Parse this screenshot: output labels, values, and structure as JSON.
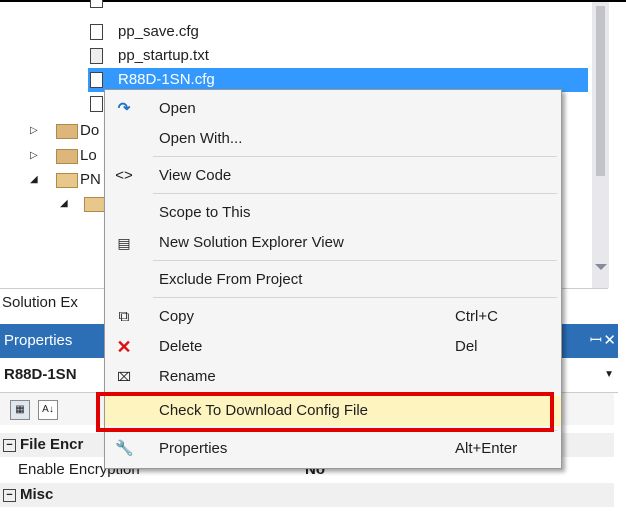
{
  "tree": {
    "items": [
      {
        "label": "pp_save.cfg",
        "type": "file"
      },
      {
        "label": "pp_startup.txt",
        "type": "file"
      },
      {
        "label": "R88D-1SN.cfg",
        "type": "file",
        "selected": true
      },
      {
        "label": "",
        "type": "file"
      },
      {
        "label": "Do",
        "type": "folder",
        "expander": "▷"
      },
      {
        "label": "Lo",
        "type": "folder",
        "expander": "▷"
      },
      {
        "label": "PN",
        "type": "folder",
        "expander": "◢"
      },
      {
        "label": "",
        "type": "folder",
        "expander": "◢"
      }
    ]
  },
  "solution_explorer_tab": "Solution Ex",
  "properties": {
    "header": "Properties",
    "pin": "ꟷ",
    "close": "✕",
    "object": "R88D-1SN",
    "categories": [
      {
        "label": "File Encr",
        "expander": "⊟"
      },
      {
        "label": "Misc",
        "expander": "⊟"
      }
    ],
    "rows": [
      {
        "key": "Enable Encryption",
        "value": "No"
      }
    ]
  },
  "context_menu": {
    "items": [
      {
        "label": "Open",
        "icon": "open-arrow-icon",
        "shortcut": ""
      },
      {
        "label": "Open With...",
        "icon": "",
        "shortcut": ""
      },
      {
        "label": "View Code",
        "icon": "code-icon",
        "shortcut": ""
      },
      {
        "label": "Scope to This",
        "icon": "",
        "shortcut": ""
      },
      {
        "label": "New Solution Explorer View",
        "icon": "new-view-icon",
        "shortcut": ""
      },
      {
        "label": "Exclude From Project",
        "icon": "",
        "shortcut": ""
      },
      {
        "label": "Copy",
        "icon": "copy-icon",
        "shortcut": "Ctrl+C"
      },
      {
        "label": "Delete",
        "icon": "delete-icon",
        "shortcut": "Del"
      },
      {
        "label": "Rename",
        "icon": "rename-icon",
        "shortcut": ""
      },
      {
        "label": "Check To Download Config File",
        "icon": "",
        "shortcut": ""
      },
      {
        "label": "Properties",
        "icon": "wrench-icon",
        "shortcut": "Alt+Enter"
      }
    ]
  },
  "colors": {
    "selection": "#3399ff",
    "properties_header": "#2d6fb7",
    "highlight": "#fdf4bf",
    "callout": "#e00000"
  }
}
